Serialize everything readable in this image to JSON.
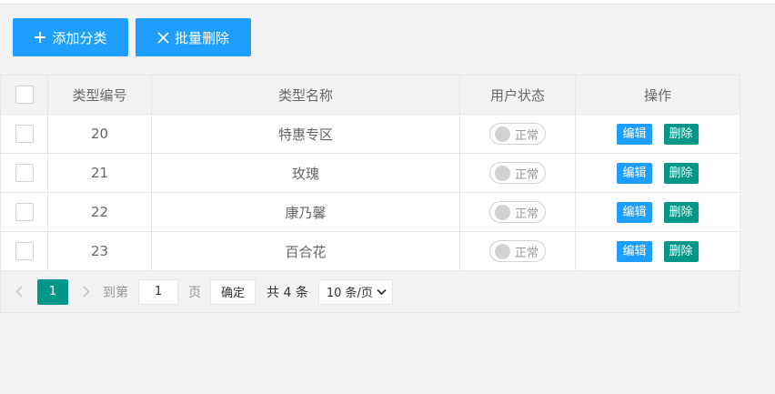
{
  "toolbar": {
    "add_label": "添加分类",
    "batch_delete_label": "批量删除",
    "add_icon": "plus-icon",
    "batch_delete_icon": "close-icon"
  },
  "table": {
    "headers": [
      "类型编号",
      "类型名称",
      "用户状态",
      "操作"
    ],
    "rows": [
      {
        "id": "20",
        "name": "特惠专区",
        "status": "正常"
      },
      {
        "id": "21",
        "name": "玫瑰",
        "status": "正常"
      },
      {
        "id": "22",
        "name": "康乃馨",
        "status": "正常"
      },
      {
        "id": "23",
        "name": "百合花",
        "status": "正常"
      }
    ],
    "edit_label": "编辑",
    "delete_label": "删除"
  },
  "pager": {
    "current_page": "1",
    "goto_label": "到第",
    "goto_value": "1",
    "page_unit": "页",
    "confirm_label": "确定",
    "total_label": "共 4 条",
    "page_size_label": "10 条/页"
  },
  "colors": {
    "primary": "#1e9fff",
    "success": "#009688",
    "background": "#f2f2f2",
    "border": "#e6e6e6"
  }
}
